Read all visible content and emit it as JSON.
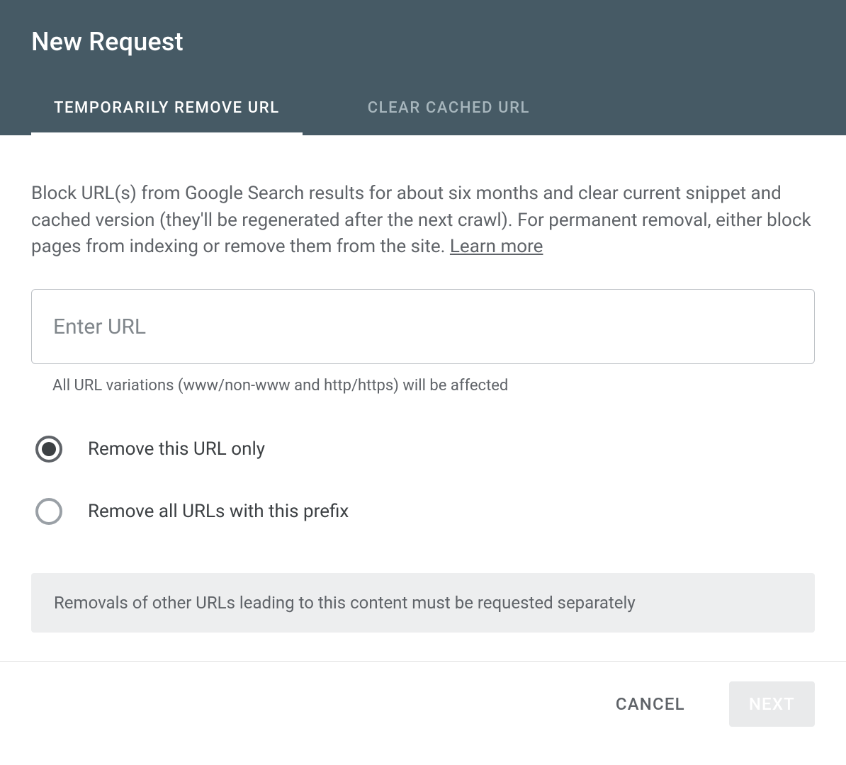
{
  "header": {
    "title": "New Request",
    "tabs": [
      {
        "label": "TEMPORARILY REMOVE URL",
        "active": true
      },
      {
        "label": "CLEAR CACHED URL",
        "active": false
      }
    ]
  },
  "body": {
    "description_pre": "Block URL(s) from Google Search results for about six months and clear current snippet and cached version (they'll be regenerated after the next crawl). For permanent removal, either block pages from indexing or remove them from the site. ",
    "learn_more": "Learn more",
    "url_input": {
      "placeholder": "Enter URL",
      "value": ""
    },
    "helper_text": "All URL variations (www/non-www and http/https) will be affected",
    "radio_options": [
      {
        "label": "Remove this URL only",
        "selected": true
      },
      {
        "label": "Remove all URLs with this prefix",
        "selected": false
      }
    ],
    "notice": "Removals of other URLs leading to this content must be requested separately"
  },
  "footer": {
    "cancel": "CANCEL",
    "next": "NEXT"
  }
}
